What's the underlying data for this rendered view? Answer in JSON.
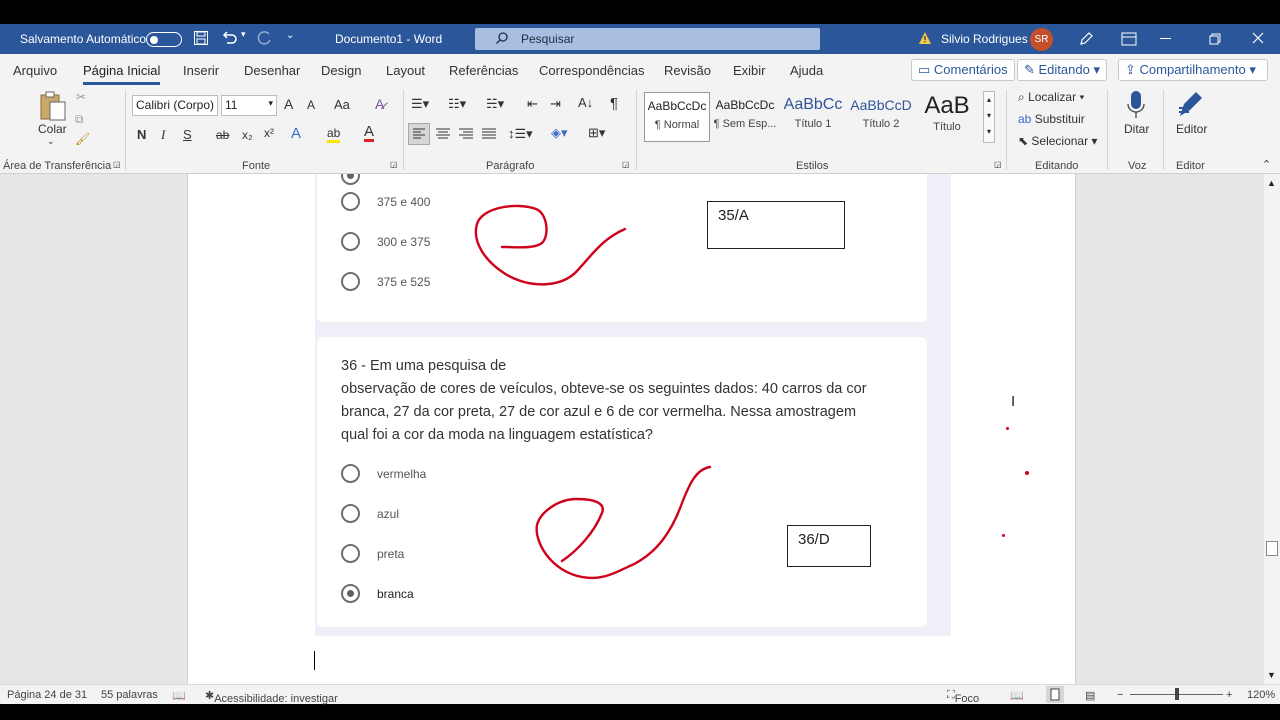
{
  "titlebar": {
    "autosave_label": "Salvamento Automático",
    "doc_title": "Documento1 - Word",
    "search_placeholder": "Pesquisar",
    "user_name": "Silvio Rodrigues",
    "user_initials": "SR"
  },
  "menu": {
    "tabs": [
      "Arquivo",
      "Página Inicial",
      "Inserir",
      "Desenhar",
      "Design",
      "Layout",
      "Referências",
      "Correspondências",
      "Revisão",
      "Exibir",
      "Ajuda"
    ],
    "comments": "Comentários",
    "editing": "Editando",
    "share": "Compartilhamento"
  },
  "ribbon": {
    "clipboard": {
      "paste": "Colar",
      "group": "Área de Transferência"
    },
    "font": {
      "name": "Calibri (Corpo)",
      "size": "11",
      "grow": "A",
      "shrink": "A",
      "case": "Aa",
      "bold": "N",
      "italic": "I",
      "underline": "S",
      "strike": "ab",
      "sub": "x₂",
      "sup": "x²",
      "effects": "A",
      "highlight": "ab",
      "color": "A",
      "group": "Fonte"
    },
    "paragraph": {
      "group": "Parágrafo",
      "pilcrow": "¶"
    },
    "styles": {
      "group": "Estilos",
      "items": [
        {
          "preview": "AaBbCcDc",
          "name": "¶ Normal"
        },
        {
          "preview": "AaBbCcDc",
          "name": "¶ Sem Esp..."
        },
        {
          "preview": "AaBbCc",
          "name": "Título 1"
        },
        {
          "preview": "AaBbCcD",
          "name": "Título 2"
        },
        {
          "preview": "AaB",
          "name": "Título"
        }
      ]
    },
    "editing": {
      "find": "Localizar",
      "replace": "Substituir",
      "select": "Selecionar",
      "group": "Editando"
    },
    "voice": {
      "dictate": "Ditar",
      "group": "Voz"
    },
    "editor": {
      "label": "Editor",
      "group": "Editor"
    }
  },
  "document": {
    "q35": {
      "options": [
        "375 e 400",
        "300 e 375",
        "375 e 525"
      ],
      "answer_box": "35/A"
    },
    "q36": {
      "question_lines": [
        "36 - Em uma pesquisa de",
        "observação de cores de veículos, obteve-se os seguintes dados: 40 carros da cor",
        "branca, 27 da cor preta, 27 de cor azul e 6 de cor vermelha. Nessa amostragem",
        "qual foi a cor da moda na linguagem estatística?"
      ],
      "options": [
        "vermelha",
        "azul",
        "preta",
        "branca"
      ],
      "selected": "branca",
      "answer_box": "36/D"
    },
    "ink_color": "#d0021b"
  },
  "status": {
    "page": "Página 24 de 31",
    "words": "55 palavras",
    "accessibility": "Acessibilidade: investigar",
    "focus": "Foco",
    "zoom": "120%"
  },
  "colors": {
    "brand": "#2b579a",
    "ribbon_bg": "#f3f3f3"
  }
}
